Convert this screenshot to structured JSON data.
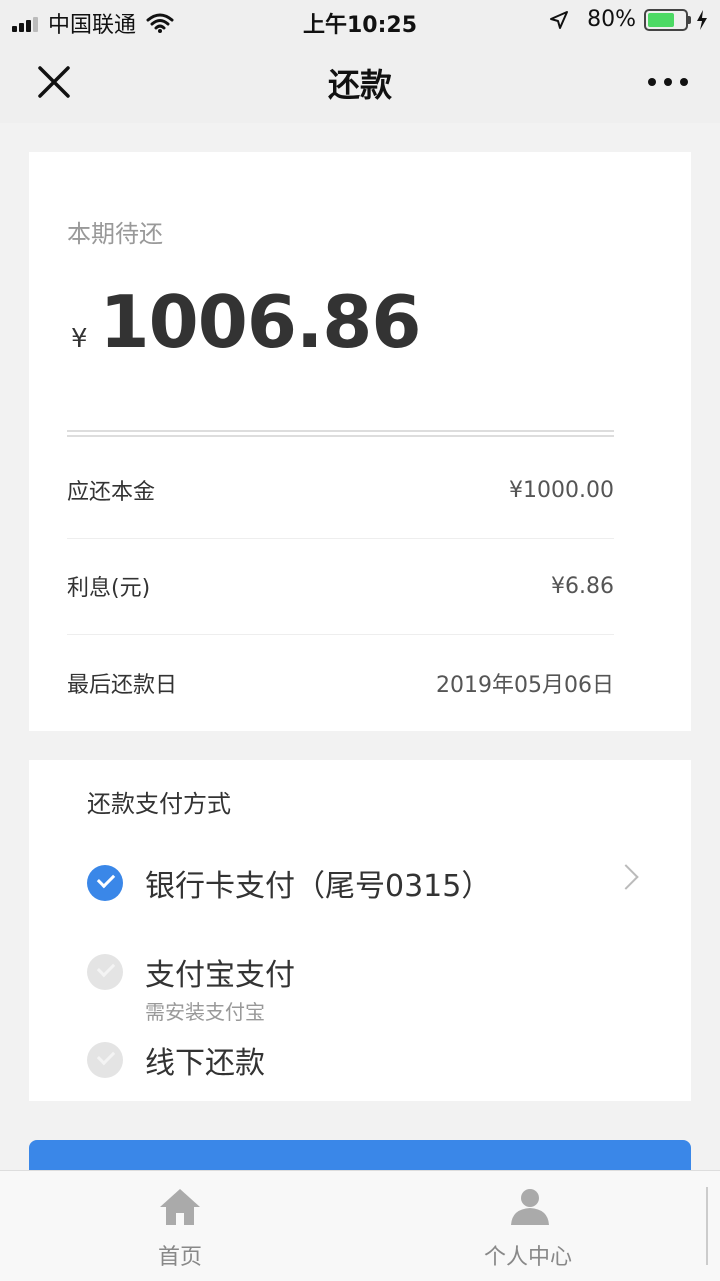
{
  "status_bar": {
    "carrier": "中国联通",
    "time": "上午10:25",
    "battery_text": "80%",
    "battery_level": 0.8
  },
  "nav": {
    "title": "还款"
  },
  "summary": {
    "label": "本期待还",
    "currency_symbol": "¥",
    "amount": "1006.86",
    "rows": [
      {
        "label": "应还本金",
        "value": "¥1000.00"
      },
      {
        "label": "利息(元)",
        "value": "¥6.86"
      },
      {
        "label": "最后还款日",
        "value": "2019年05月06日"
      }
    ]
  },
  "payment": {
    "title": "还款支付方式",
    "methods": [
      {
        "label": "银行卡支付（尾号0315）",
        "selected": true
      },
      {
        "label": "支付宝支付",
        "subtext": "需安装支付宝",
        "selected": false
      },
      {
        "label": "线下还款",
        "selected": false
      }
    ]
  },
  "tabs": [
    {
      "label": "首页",
      "icon": "home-icon"
    },
    {
      "label": "个人中心",
      "icon": "user-icon"
    }
  ],
  "colors": {
    "accent": "#3a87e8",
    "battery": "#4cd964"
  }
}
